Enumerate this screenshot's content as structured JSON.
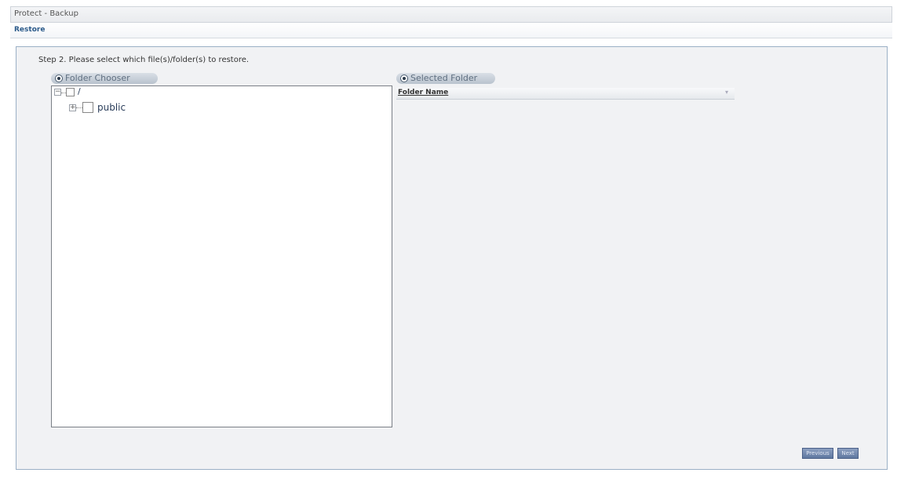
{
  "header": {
    "breadcrumb": "Protect - Backup"
  },
  "tabs": [
    {
      "label": "Restore"
    }
  ],
  "step": {
    "instruction": "Step 2. Please select which file(s)/folder(s) to restore."
  },
  "folder_chooser": {
    "title": "Folder Chooser",
    "tree": [
      {
        "label": "/",
        "expander": "−",
        "checked": false
      },
      {
        "label": "public",
        "expander": "+",
        "checked": false
      }
    ]
  },
  "selected_folder": {
    "title": "Selected Folder",
    "columns": [
      "Folder Name"
    ],
    "rows": []
  },
  "buttons": {
    "previous": "Previous",
    "next": "Next"
  },
  "icons": {
    "section": "radio-bullet-icon",
    "collapse": "minus-box-icon",
    "expand": "plus-box-icon",
    "sort": "sort-indicator-icon"
  }
}
